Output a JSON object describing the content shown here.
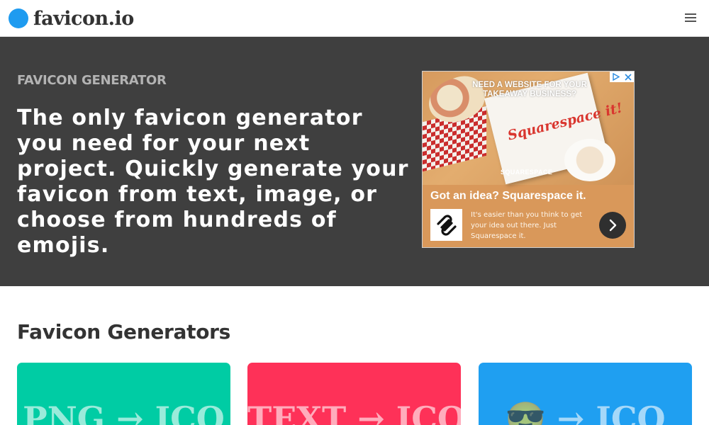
{
  "header": {
    "brand": "favicon.io",
    "menu_icon": "hamburger-menu-icon"
  },
  "hero": {
    "eyebrow": "FAVICON GENERATOR",
    "lead": "The only favicon generator you need for your next project. Quickly generate your favicon from text, image, or choose from hundreds of emojis."
  },
  "ad": {
    "headline": "NEED A WEBSITE FOR YOUR TAKEAWAY BUSINESS?",
    "box_text": "Squarespace it!",
    "brand_mark": "SQUARESPACE",
    "tagline": "Got an idea? Squarespace it.",
    "body": "It's easier than you think to get your idea out there. Just Squarespace it.",
    "badge_icons": [
      "adchoices-icon",
      "close-icon"
    ]
  },
  "generators": {
    "title": "Favicon Generators",
    "cards": [
      {
        "label": "PNG → ICO",
        "color": "#00cca4"
      },
      {
        "label": "TEXT → ICO",
        "color": "#fe3158"
      },
      {
        "label": "😎 → ICO",
        "color": "#1f9ff1"
      }
    ]
  },
  "colors": {
    "brand_blue": "#1e9bf0",
    "hero_bg": "#3f3f3f"
  }
}
